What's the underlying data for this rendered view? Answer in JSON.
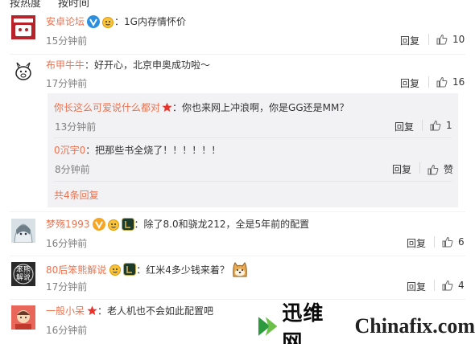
{
  "sortbar": {
    "hot": "按热度",
    "time": "按时间"
  },
  "comments": [
    {
      "user": "安卓论坛",
      "text": "：1G内存情怀价",
      "time": "15分钟前",
      "reply": "回复",
      "likes": "10",
      "avatar_text": "ANDROID FORUM"
    },
    {
      "user": "布甲牛牛",
      "text": "：好开心，北京申奥成功啦～",
      "time": "17分钟前",
      "reply": "回复",
      "likes": "16",
      "sub": [
        {
          "user": "你长这么可爱说什么都对",
          "text": "：你也来网上冲浪啊，你是GG还是MM？",
          "time": "13分钟前",
          "reply": "回复",
          "likes": "1"
        },
        {
          "user": "0沉宇0",
          "text": "：把那些书全烧了！！！！！！",
          "time": "8分钟前",
          "reply": "回复",
          "likes": "赞"
        }
      ],
      "more": "共4条回复"
    },
    {
      "user": "梦殇1993",
      "text": "：除了8.0和骁龙212，全是5年前的配置",
      "time": "16分钟前",
      "reply": "回复",
      "likes": "6"
    },
    {
      "user": "80后笨熊解说",
      "text": "：红米4多少钱来着？",
      "time": "17分钟前",
      "reply": "回复",
      "likes": "4",
      "avatar_text": "笨熊解说"
    },
    {
      "user": "一般小呆",
      "text": "：老人机也不会如此配置吧",
      "time": "16分钟前"
    }
  ],
  "watermark": {
    "cn": "迅维网",
    "en": "Chinafix.com"
  },
  "colors": {
    "username": "#eb7350",
    "subuser": "#eb7350",
    "more": "#eb7350"
  }
}
